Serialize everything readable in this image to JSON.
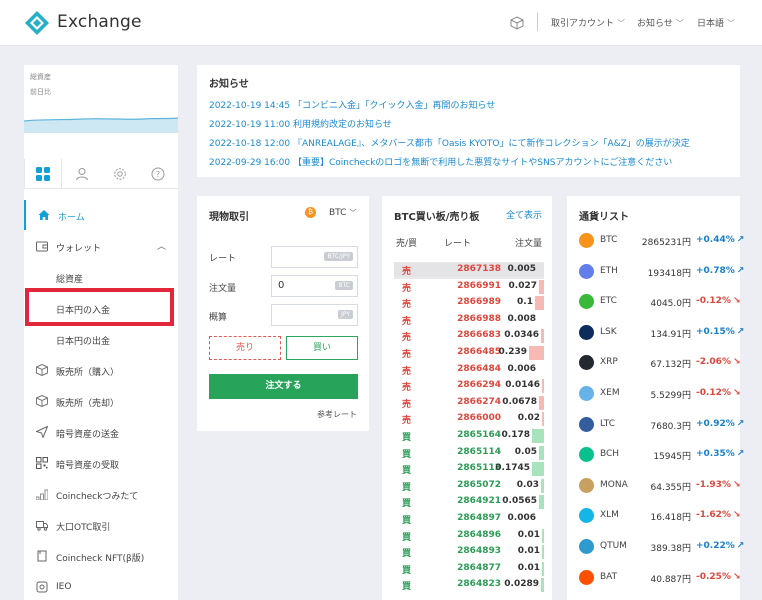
{
  "header": {
    "brand": "Exchange",
    "menu": [
      "取引アカウント",
      "お知らせ",
      "日本語"
    ],
    "brand_color": "#23b0c8"
  },
  "sidebar": {
    "total_assets_label": "総資産",
    "prev_day_label": "前日比",
    "tabs": [
      "grid-icon",
      "user-icon",
      "gear-icon",
      "help-icon"
    ],
    "items": [
      {
        "label": "ホーム",
        "icon": "home-icon"
      },
      {
        "label": "ウォレット",
        "icon": "wallet-icon"
      },
      {
        "label": "総資産",
        "icon": ""
      },
      {
        "label": "日本円の入金",
        "icon": ""
      },
      {
        "label": "日本円の出金",
        "icon": ""
      },
      {
        "label": "販売所（購入）",
        "icon": "box-icon"
      },
      {
        "label": "販売所（売却）",
        "icon": "box-icon"
      },
      {
        "label": "暗号資産の送金",
        "icon": "send-icon"
      },
      {
        "label": "暗号資産の受取",
        "icon": "qr-icon"
      },
      {
        "label": "Coincheckつみたて",
        "icon": "stack-icon"
      },
      {
        "label": "大口OTC取引",
        "icon": "truck-icon"
      },
      {
        "label": "Coincheck NFT(β版)",
        "icon": "nft-icon"
      },
      {
        "label": "IEO",
        "icon": "ieo-icon"
      }
    ]
  },
  "news": {
    "title": "お知らせ",
    "items": [
      "2022-10-19 14:45 「コンビニ入金」「クイック入金」再開のお知らせ",
      "2022-10-19 11:00 利用規約改定のお知らせ",
      "2022-10-18 12:00 『ANREALAGE』、メタバース都市「Oasis KYOTO」にて新作コレクション「A&Z」の展示が決定",
      "2022-09-29 16:00 【重要】Coincheckのロゴを無断で利用した悪質なサイトやSNSアカウントにご注意ください"
    ]
  },
  "trade": {
    "title": "現物取引",
    "coin": "BTC",
    "rate_label": "レート",
    "rate_unit": "BTC/JPY",
    "amount_label": "注文量",
    "amount_value": "0",
    "amount_unit": "BTC",
    "estimate_label": "概算",
    "estimate_unit": "JPY",
    "sell_label": "売り",
    "buy_label": "買い",
    "order_label": "注文する",
    "ref_link": "参考レート"
  },
  "orderbook": {
    "title": "BTC買い板/売り板",
    "show_all": "全て表示",
    "col_side": "売/買",
    "col_rate": "レート",
    "col_qty": "注文量",
    "sell_label": "売",
    "buy_label": "買",
    "rows": [
      {
        "side": "sell",
        "price": "2867138",
        "qty": "0.005",
        "depth": 1.0
      },
      {
        "side": "sell",
        "price": "2866991",
        "qty": "0.027",
        "depth": 0.03
      },
      {
        "side": "sell",
        "price": "2866989",
        "qty": "0.1",
        "depth": 0.06
      },
      {
        "side": "sell",
        "price": "2866988",
        "qty": "0.008",
        "depth": 0.0
      },
      {
        "side": "sell",
        "price": "2866683",
        "qty": "0.0346",
        "depth": 0.02
      },
      {
        "side": "sell",
        "price": "2866485",
        "qty": "0.239",
        "depth": 0.1
      },
      {
        "side": "sell",
        "price": "2866484",
        "qty": "0.006",
        "depth": 0.0
      },
      {
        "side": "sell",
        "price": "2866294",
        "qty": "0.0146",
        "depth": 0.01
      },
      {
        "side": "sell",
        "price": "2866274",
        "qty": "0.0678",
        "depth": 0.03
      },
      {
        "side": "sell",
        "price": "2866000",
        "qty": "0.02",
        "depth": 0.01
      },
      {
        "side": "buy",
        "price": "2865164",
        "qty": "0.178",
        "depth": 0.08
      },
      {
        "side": "buy",
        "price": "2865114",
        "qty": "0.05",
        "depth": 0.03
      },
      {
        "side": "buy",
        "price": "2865113",
        "qty": "0.1745",
        "depth": 0.08
      },
      {
        "side": "buy",
        "price": "2865072",
        "qty": "0.03",
        "depth": 0.02
      },
      {
        "side": "buy",
        "price": "2864921",
        "qty": "0.0565",
        "depth": 0.03
      },
      {
        "side": "buy",
        "price": "2864897",
        "qty": "0.006",
        "depth": 0.0
      },
      {
        "side": "buy",
        "price": "2864896",
        "qty": "0.01",
        "depth": 0.01
      },
      {
        "side": "buy",
        "price": "2864893",
        "qty": "0.01",
        "depth": 0.01
      },
      {
        "side": "buy",
        "price": "2864877",
        "qty": "0.01",
        "depth": 0.01
      },
      {
        "side": "buy",
        "price": "2864823",
        "qty": "0.0289",
        "depth": 0.02
      }
    ]
  },
  "coins": {
    "title": "通貨リスト",
    "items": [
      {
        "sym": "BTC",
        "price": "2865231円",
        "chg": "+0.44%",
        "dir": "up",
        "color": "#f7931a"
      },
      {
        "sym": "ETH",
        "price": "193418円",
        "chg": "+0.78%",
        "dir": "up",
        "color": "#627eea"
      },
      {
        "sym": "ETC",
        "price": "4045.0円",
        "chg": "-0.12%",
        "dir": "down",
        "color": "#3ab83a"
      },
      {
        "sym": "LSK",
        "price": "134.91円",
        "chg": "+0.15%",
        "dir": "up",
        "color": "#0d2b5c"
      },
      {
        "sym": "XRP",
        "price": "67.132円",
        "chg": "-2.06%",
        "dir": "down",
        "color": "#23292f"
      },
      {
        "sym": "XEM",
        "price": "5.5299円",
        "chg": "-0.12%",
        "dir": "down",
        "color": "#67b2e8"
      },
      {
        "sym": "LTC",
        "price": "7680.3円",
        "chg": "+0.92%",
        "dir": "up",
        "color": "#345d9d"
      },
      {
        "sym": "BCH",
        "price": "15945円",
        "chg": "+0.35%",
        "dir": "up",
        "color": "#0ac18e"
      },
      {
        "sym": "MONA",
        "price": "64.355円",
        "chg": "-1.93%",
        "dir": "down",
        "color": "#c8a060"
      },
      {
        "sym": "XLM",
        "price": "16.418円",
        "chg": "-1.62%",
        "dir": "down",
        "color": "#14b6e7"
      },
      {
        "sym": "QTUM",
        "price": "389.38円",
        "chg": "+0.22%",
        "dir": "up",
        "color": "#2e9ad0"
      },
      {
        "sym": "BAT",
        "price": "40.887円",
        "chg": "-0.25%",
        "dir": "down",
        "color": "#ff5000"
      }
    ]
  }
}
